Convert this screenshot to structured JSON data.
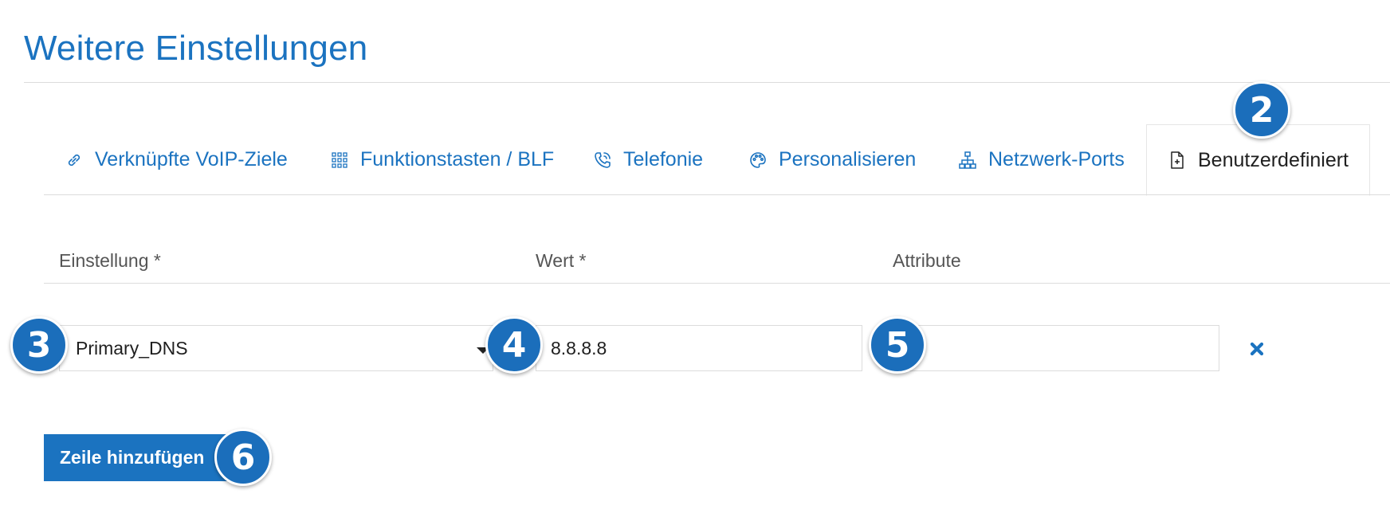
{
  "page": {
    "title": "Weitere Einstellungen"
  },
  "tabs": [
    {
      "label": "Verknüpfte VoIP-Ziele",
      "icon": "link-icon"
    },
    {
      "label": "Funktionstasten / BLF",
      "icon": "grid-icon"
    },
    {
      "label": "Telefonie",
      "icon": "phone-icon"
    },
    {
      "label": "Personalisieren",
      "icon": "palette-icon"
    },
    {
      "label": "Netzwerk-Ports",
      "icon": "network-icon"
    },
    {
      "label": "Benutzerdefiniert",
      "icon": "file-plus-icon",
      "active": true
    }
  ],
  "table": {
    "headers": {
      "setting": "Einstellung *",
      "value": "Wert *",
      "attributes": "Attribute"
    },
    "rows": [
      {
        "setting": "Primary_DNS",
        "value": "8.8.8.8",
        "attributes": ""
      }
    ]
  },
  "actions": {
    "add_row_label": "Zeile hinzufügen"
  },
  "callouts": [
    "2",
    "3",
    "4",
    "5",
    "6"
  ],
  "colors": {
    "accent": "#1b73c0",
    "callout": "#1b6ebb",
    "border": "#dcdcdc"
  }
}
